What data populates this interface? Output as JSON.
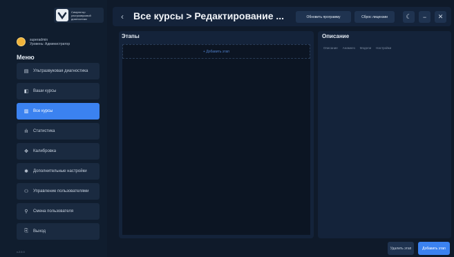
{
  "sidebar": {
    "logo_lines": [
      "Симулятор",
      "ультразвуковой",
      "диагностики"
    ],
    "user_name": "superadmin",
    "user_role": "Уровень: Администратор",
    "menu_title": "Меню",
    "items": [
      {
        "label": "Ультразвуковая диагностика",
        "icon": "probe-icon"
      },
      {
        "label": "Ваши курсы",
        "icon": "book-icon"
      },
      {
        "label": "Все курсы",
        "icon": "books-icon"
      },
      {
        "label": "Статистика",
        "icon": "bar-chart-icon"
      },
      {
        "label": "Калибровка",
        "icon": "crosshair-icon"
      },
      {
        "label": "Дополнительные настройки",
        "icon": "gear-icon"
      },
      {
        "label": "Управление пользователями",
        "icon": "users-icon"
      },
      {
        "label": "Смена пользователя",
        "icon": "user-icon"
      },
      {
        "label": "Выход",
        "icon": "exit-icon"
      }
    ],
    "active_index": 2,
    "version": "v.2.0.0"
  },
  "header": {
    "title": "Все курсы > Редактирование ...",
    "update_program": "Обновить программу",
    "reset_license": "Сброс лицензии"
  },
  "stages": {
    "title": "Этапы",
    "add_stage": "+ Добавить этап"
  },
  "description": {
    "title": "Описание",
    "tabs": [
      "Описание",
      "Анамнез",
      "Модели",
      "Настройки"
    ]
  },
  "footer": {
    "delete_stage": "Удалить этап",
    "add_stage": "Добавить этап"
  },
  "colors": {
    "accent": "#3b82f0",
    "background": "#0f1a2a",
    "panel": "#14233a"
  }
}
